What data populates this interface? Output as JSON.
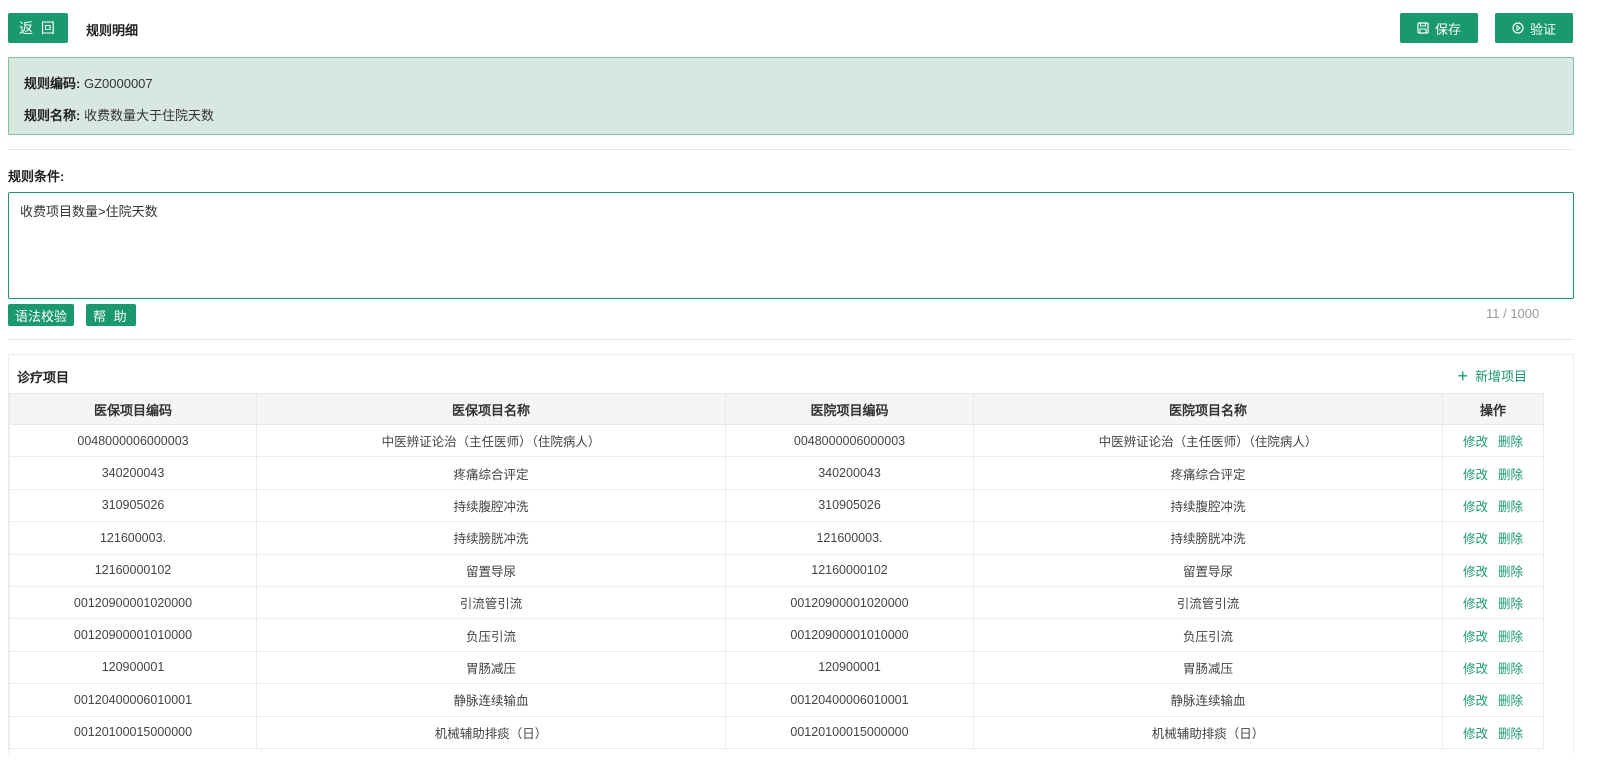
{
  "header": {
    "back_label": "返 回",
    "title": "规则明细",
    "save_label": "保存",
    "verify_label": "验证"
  },
  "rule_info": {
    "code_key": "规则编码:",
    "code_value": "GZ0000007",
    "name_key": "规则名称:",
    "name_value": "收费数量大于住院天数"
  },
  "conditions": {
    "label": "规则条件:",
    "value": "收费项目数量>住院天数",
    "syntax_check_label": "语法校验",
    "help_label": "帮 助",
    "char_count": "11 / 1000"
  },
  "items_table": {
    "title": "诊疗项目",
    "add_label": "新增项目",
    "columns": [
      "医保项目编码",
      "医保项目名称",
      "医院项目编码",
      "医院项目名称",
      "操作"
    ],
    "edit_label": "修改",
    "delete_label": "删除",
    "rows": [
      {
        "ins_code": "0048000006000003",
        "ins_name": "中医辨证论治（主任医师）（住院病人）",
        "hosp_code": "0048000006000003",
        "hosp_name": "中医辨证论治（主任医师）（住院病人）"
      },
      {
        "ins_code": "340200043",
        "ins_name": "疼痛综合评定",
        "hosp_code": "340200043",
        "hosp_name": "疼痛综合评定"
      },
      {
        "ins_code": "310905026",
        "ins_name": "持续腹腔冲洗",
        "hosp_code": "310905026",
        "hosp_name": "持续腹腔冲洗"
      },
      {
        "ins_code": "121600003.",
        "ins_name": "持续膀胱冲洗",
        "hosp_code": "121600003.",
        "hosp_name": "持续膀胱冲洗"
      },
      {
        "ins_code": "12160000102",
        "ins_name": "留置导尿",
        "hosp_code": "12160000102",
        "hosp_name": "留置导尿"
      },
      {
        "ins_code": "00120900001020000",
        "ins_name": "引流管引流",
        "hosp_code": "00120900001020000",
        "hosp_name": "引流管引流"
      },
      {
        "ins_code": "00120900001010000",
        "ins_name": "负压引流",
        "hosp_code": "00120900001010000",
        "hosp_name": "负压引流"
      },
      {
        "ins_code": "120900001",
        "ins_name": "胃肠减压",
        "hosp_code": "120900001",
        "hosp_name": "胃肠减压"
      },
      {
        "ins_code": "00120400006010001",
        "ins_name": "静脉连续输血",
        "hosp_code": "00120400006010001",
        "hosp_name": "静脉连续输血"
      },
      {
        "ins_code": "00120100015000000",
        "ins_name": "机械辅助排痰（日）",
        "hosp_code": "00120100015000000",
        "hosp_name": "机械辅助排痰（日）"
      }
    ]
  },
  "icons": {
    "save": "save-icon",
    "verify": "play-circle-icon",
    "add": "plus-icon"
  },
  "colors": {
    "accent": "#1a9a6c",
    "info_panel_bg": "#d8e7df"
  }
}
